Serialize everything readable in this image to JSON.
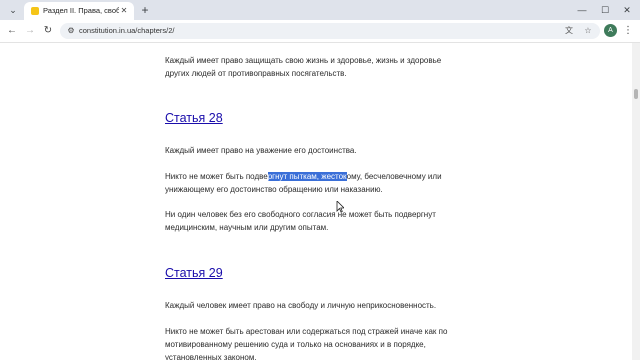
{
  "browser": {
    "tab": {
      "title": "Раздел II. Права, свободы и о"
    },
    "url": "constitution.in.ua/chapters/2/",
    "profile_initial": "A"
  },
  "article": {
    "p_intro": "Каждый имеет право защищать свою жизнь и здоровье, жизнь и здоровье других людей от противоправных посягательств.",
    "a28_title": "Статья 28",
    "a28_p1": "Каждый имеет право на уважение его достоинства.",
    "a28_p2_before": "Никто не может быть подве",
    "a28_p2_selected": "ргнут пыткам, жесток",
    "a28_p2_after": "ому, бесчеловечному или унижающему его достоинство обращению или наказанию.",
    "a28_p3": "Ни один человек без его свободного согласия не может быть подвергнут медицинским, научным или другим опытам.",
    "a29_title": "Статья 29",
    "a29_p1": "Каждый человек имеет право на свободу и личную неприкосновенность.",
    "a29_p2": "Никто не может быть арестован или содержаться под стражей иначе как по мотивированному решению суда и только на основаниях и в порядке, установленных законом."
  }
}
